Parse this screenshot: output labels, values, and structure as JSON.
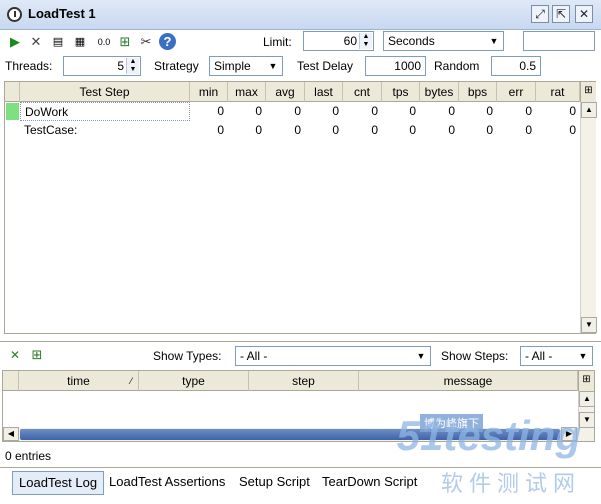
{
  "window": {
    "title": "LoadTest 1"
  },
  "toolbar": {
    "limit_label": "Limit:",
    "limit_value": "60",
    "limit_unit": "Seconds",
    "zero_label": "0.0"
  },
  "settings": {
    "threads_label": "Threads:",
    "threads_value": "5",
    "strategy_label": "Strategy",
    "strategy_value": "Simple",
    "test_delay_label": "Test Delay",
    "test_delay_value": "1000",
    "random_label": "Random",
    "random_value": "0.5"
  },
  "stats_table": {
    "columns": [
      "Test Step",
      "min",
      "max",
      "avg",
      "last",
      "cnt",
      "tps",
      "bytes",
      "bps",
      "err",
      "rat"
    ],
    "rows": [
      {
        "name": "DoWork",
        "values": [
          "0",
          "0",
          "0",
          "0",
          "0",
          "0",
          "0",
          "0",
          "0",
          "0"
        ]
      },
      {
        "name": "TestCase:",
        "values": [
          "0",
          "0",
          "0",
          "0",
          "0",
          "0",
          "0",
          "0",
          "0",
          "0"
        ]
      }
    ]
  },
  "log": {
    "show_types_label": "Show Types:",
    "show_types_value": "- All -",
    "show_steps_label": "Show Steps:",
    "show_steps_value": "- All -",
    "columns": [
      "time",
      "type",
      "step",
      "message"
    ],
    "entries_label": "0 entries"
  },
  "tabs": [
    "LoadTest Log",
    "LoadTest Assertions",
    "Setup Script",
    "TearDown Script"
  ],
  "watermark": {
    "tag": "博为峰旗下",
    "brand": "51testing",
    "sub": "软件测试网"
  },
  "colors": {
    "accent": "#3f63a6",
    "status_green": "#7fe07f"
  }
}
